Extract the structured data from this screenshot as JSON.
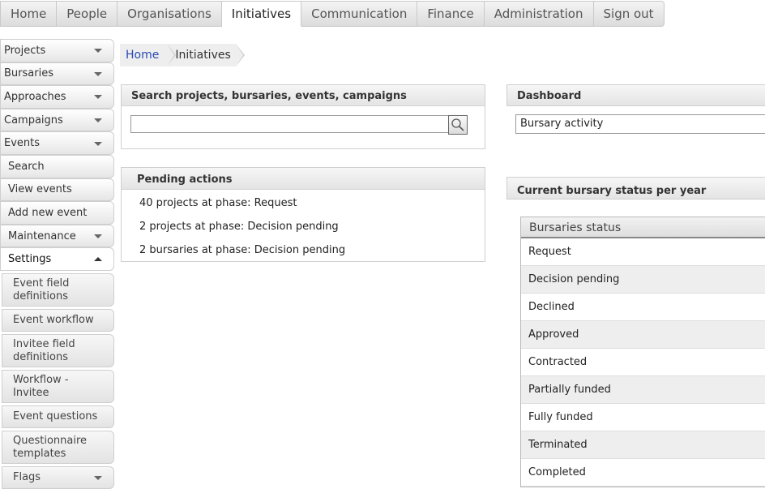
{
  "topnav": {
    "tabs": [
      {
        "label": "Home"
      },
      {
        "label": "People"
      },
      {
        "label": "Organisations"
      },
      {
        "label": "Initiatives"
      },
      {
        "label": "Communication"
      },
      {
        "label": "Finance"
      },
      {
        "label": "Administration"
      },
      {
        "label": "Sign out"
      }
    ],
    "active": "Initiatives"
  },
  "sidebar": {
    "items": [
      {
        "label": "Projects"
      },
      {
        "label": "Bursaries"
      },
      {
        "label": "Approaches"
      },
      {
        "label": "Campaigns"
      },
      {
        "label": "Events"
      },
      {
        "label": "Search"
      },
      {
        "label": "View events"
      },
      {
        "label": "Add new event"
      },
      {
        "label": "Maintenance"
      },
      {
        "label": "Settings"
      }
    ],
    "settings_sub": [
      {
        "label": "Event field definitions"
      },
      {
        "label": "Event workflow"
      },
      {
        "label": "Invitee field definitions"
      },
      {
        "label": "Workflow - Invitee"
      },
      {
        "label": "Event questions"
      },
      {
        "label": "Questionnaire templates"
      },
      {
        "label": "Flags"
      }
    ]
  },
  "breadcrumb": {
    "home": "Home",
    "current": "Initiatives"
  },
  "search": {
    "title": "Search projects, bursaries, events, campaigns",
    "value": "",
    "button_icon": "search-icon"
  },
  "pending": {
    "title": "Pending actions",
    "items": [
      "40 projects at phase: Request",
      "2 projects at phase: Decision pending",
      "2 bursaries at phase: Decision pending"
    ]
  },
  "dashboard": {
    "title": "Dashboard",
    "selected": "Bursary activity"
  },
  "status": {
    "section_title": "Current bursary status per year",
    "table_header": "Bursaries status",
    "rows": [
      "Request",
      "Decision pending",
      "Declined",
      "Approved",
      "Contracted",
      "Partially funded",
      "Fully funded",
      "Terminated",
      "Completed"
    ]
  },
  "colors": {
    "link": "#2a49b3",
    "panel_border": "#cfcfcf",
    "row_alt": "#eeeeee"
  }
}
